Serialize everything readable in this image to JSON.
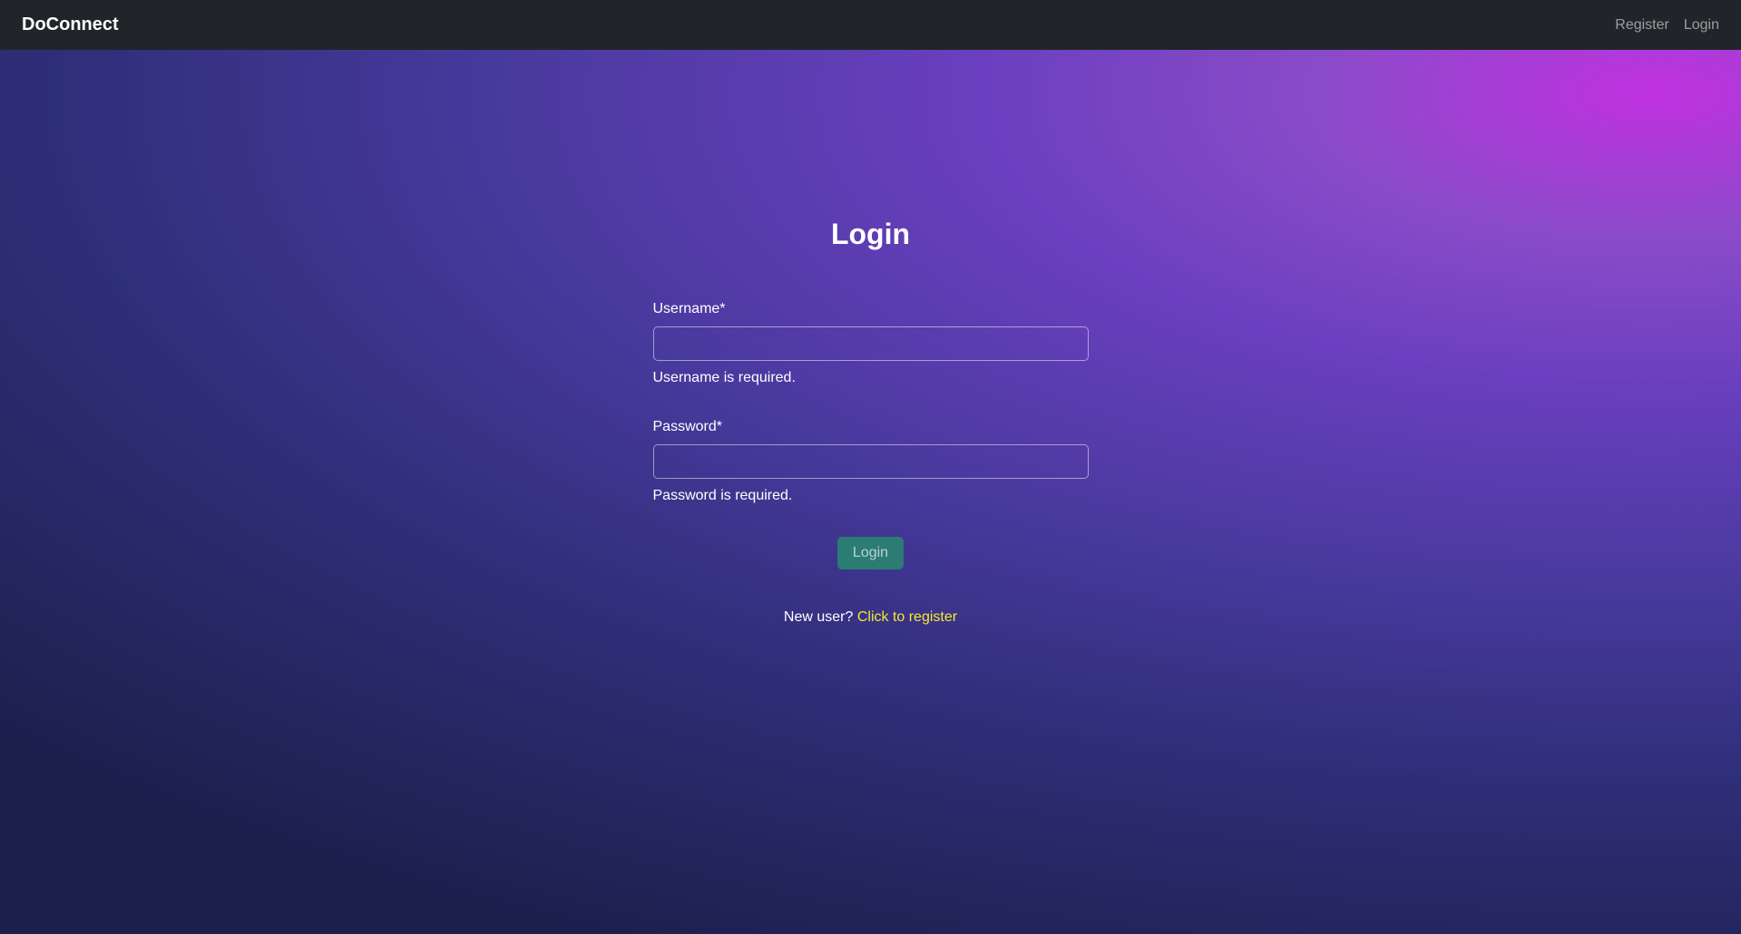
{
  "navbar": {
    "brand": "DoConnect",
    "links": {
      "register": "Register",
      "login": "Login"
    }
  },
  "page": {
    "title": "Login"
  },
  "form": {
    "username": {
      "label": "Username*",
      "value": "",
      "error": "Username is required."
    },
    "password": {
      "label": "Password*",
      "value": "",
      "error": "Password is required."
    },
    "submit_label": "Login"
  },
  "register_prompt": {
    "text": "New user? ",
    "link_text": "Click to register"
  }
}
